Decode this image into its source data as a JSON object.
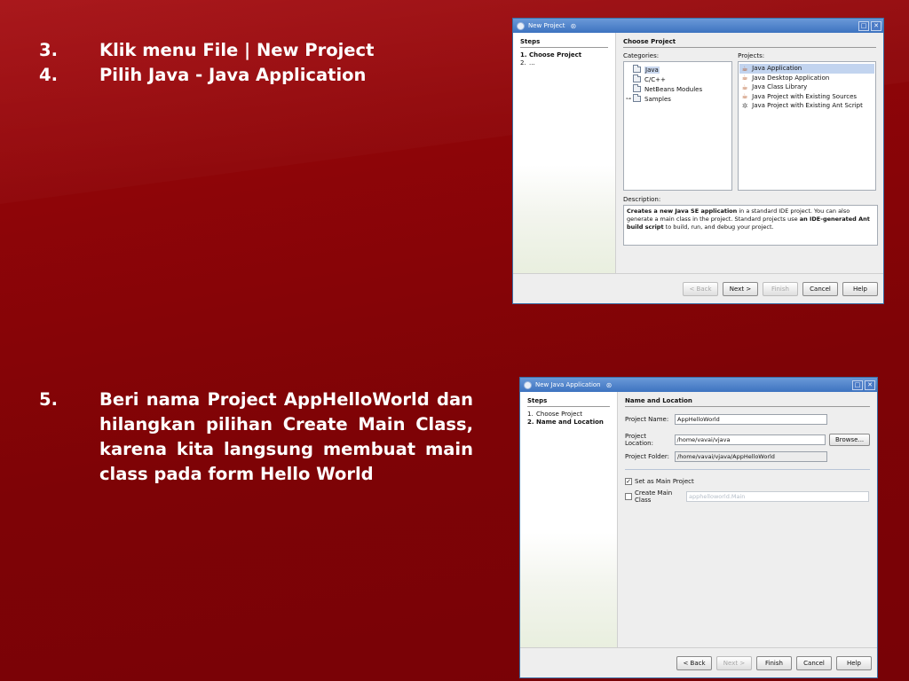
{
  "slide": {
    "bullets": [
      {
        "num": "3.",
        "text": "Klik menu File | New Project"
      },
      {
        "num": "4.",
        "text": "Pilih Java - Java Application"
      }
    ],
    "step5": {
      "num": "5.",
      "text": "Beri nama Project AppHelloWorld dan hilangkan pilihan Create Main Class, karena kita langsung membuat main class pada form Hello World"
    }
  },
  "win1": {
    "title": "New Project",
    "steps_header": "Steps",
    "steps": [
      {
        "n": "1.",
        "label": "Choose Project"
      },
      {
        "n": "2.",
        "label": "..."
      }
    ],
    "panel_title": "Choose Project",
    "categories_label": "Categories:",
    "projects_label": "Projects:",
    "categories": [
      "Java",
      "C/C++",
      "NetBeans Modules",
      "Samples"
    ],
    "projects": [
      "Java Application",
      "Java Desktop Application",
      "Java Class Library",
      "Java Project with Existing Sources",
      "Java Project with Existing Ant Script"
    ],
    "description_label": "Description:",
    "description": {
      "b1": "Creates a new Java SE application",
      "t1": " in a standard IDE project. You can also generate a main class in the project. Standard projects use ",
      "b2": "an IDE-generated Ant build script",
      "t2": " to build, run, and debug your project."
    },
    "buttons": {
      "back": "< Back",
      "next": "Next >",
      "finish": "Finish",
      "cancel": "Cancel",
      "help": "Help"
    }
  },
  "win2": {
    "title": "New Java Application",
    "steps_header": "Steps",
    "steps": [
      {
        "n": "1.",
        "label": "Choose Project"
      },
      {
        "n": "2.",
        "label": "Name and Location"
      }
    ],
    "panel_title": "Name and Location",
    "project_name_label": "Project Name:",
    "project_name": "AppHelloWorld",
    "project_location_label": "Project Location:",
    "project_location": "/home/vavai/vjava",
    "project_folder_label": "Project Folder:",
    "project_folder": "/home/vavai/vjava/AppHelloWorld",
    "browse": "Browse...",
    "set_main_label": "Set as Main Project",
    "set_main_checked": true,
    "create_main_label": "Create Main Class",
    "create_main_checked": false,
    "main_class": "apphelloworld.Main",
    "buttons": {
      "back": "< Back",
      "next": "Next >",
      "finish": "Finish",
      "cancel": "Cancel",
      "help": "Help"
    }
  }
}
